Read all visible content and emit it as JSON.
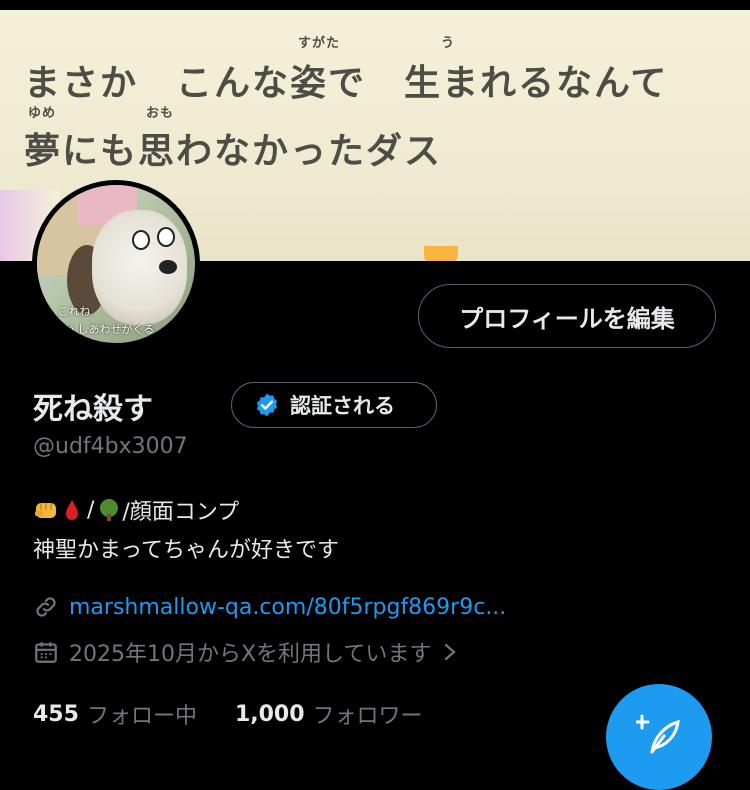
{
  "banner": {
    "line1": "まさか　こんな姿で　生まれるなんて",
    "line2": "夢にも思わなかったダス",
    "ruby": {
      "sugata": "すがた",
      "u": "う",
      "yume": "ゆめ",
      "omo": "おも"
    }
  },
  "avatar": {
    "caption1": "ん これね",
    "caption2": "か しあわせがくる"
  },
  "header": {
    "edit_profile_label": "プロフィールを編集"
  },
  "profile": {
    "display_name": "死ね殺す",
    "verify_label": "認証される",
    "handle": "@udf4bx3007",
    "bio_line1_text": "/顔面コンプ",
    "bio_line2": "神聖かまってちゃんが好きです",
    "link": "marshmallow-qa.com/80f5rpgf869r9c...",
    "joined": "2025年10月からXを利用しています"
  },
  "stats": {
    "following_count": "455",
    "following_label": "フォロー中",
    "followers_count": "1,000",
    "followers_label": "フォロワー"
  },
  "icons": [
    "verified-badge-icon",
    "link-icon",
    "calendar-icon",
    "chevron-right-icon",
    "compose-icon",
    "fist-emoji-icon",
    "drop-emoji-icon",
    "tree-emoji-icon"
  ],
  "colors": {
    "accent": "#1d9bf0",
    "muted": "#71767b",
    "text": "#e7e9ea",
    "background": "#000000"
  }
}
